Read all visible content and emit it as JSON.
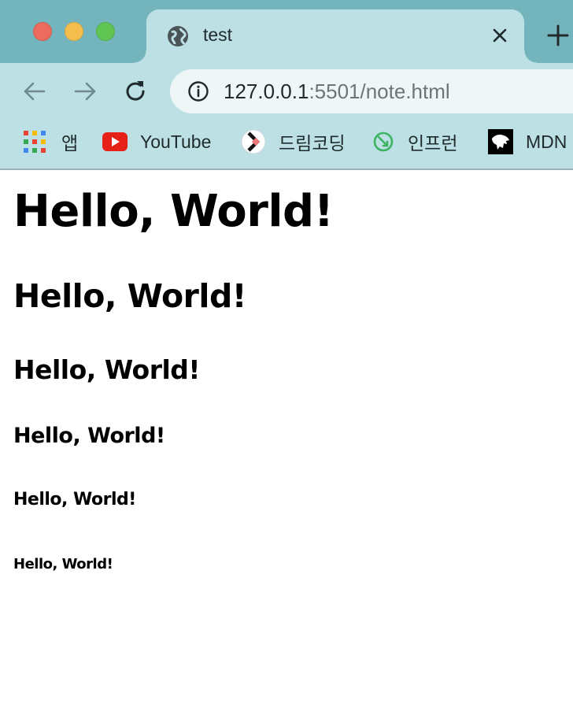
{
  "browser": {
    "tab": {
      "title": "test",
      "favicon": "globe-icon"
    },
    "address": {
      "host": "127.0.0.1",
      "rest": ":5501/note.html"
    },
    "bookmarks": [
      {
        "label": "앱",
        "icon": "apps-grid-icon"
      },
      {
        "label": "YouTube",
        "icon": "youtube-icon"
      },
      {
        "label": "드림코딩",
        "icon": "dream-coding-icon"
      },
      {
        "label": "인프런",
        "icon": "inflearn-icon"
      },
      {
        "label": "MDN",
        "icon": "mdn-icon"
      }
    ],
    "colors": {
      "frame": "#74b4bc",
      "toolbar": "#bde0e4",
      "omnibox": "#eef6f7"
    }
  },
  "page": {
    "h1": "Hello, World!",
    "h2": "Hello, World!",
    "h3": "Hello, World!",
    "h4": "Hello, World!",
    "h5": "Hello, World!",
    "h6": "Hello, World!"
  }
}
